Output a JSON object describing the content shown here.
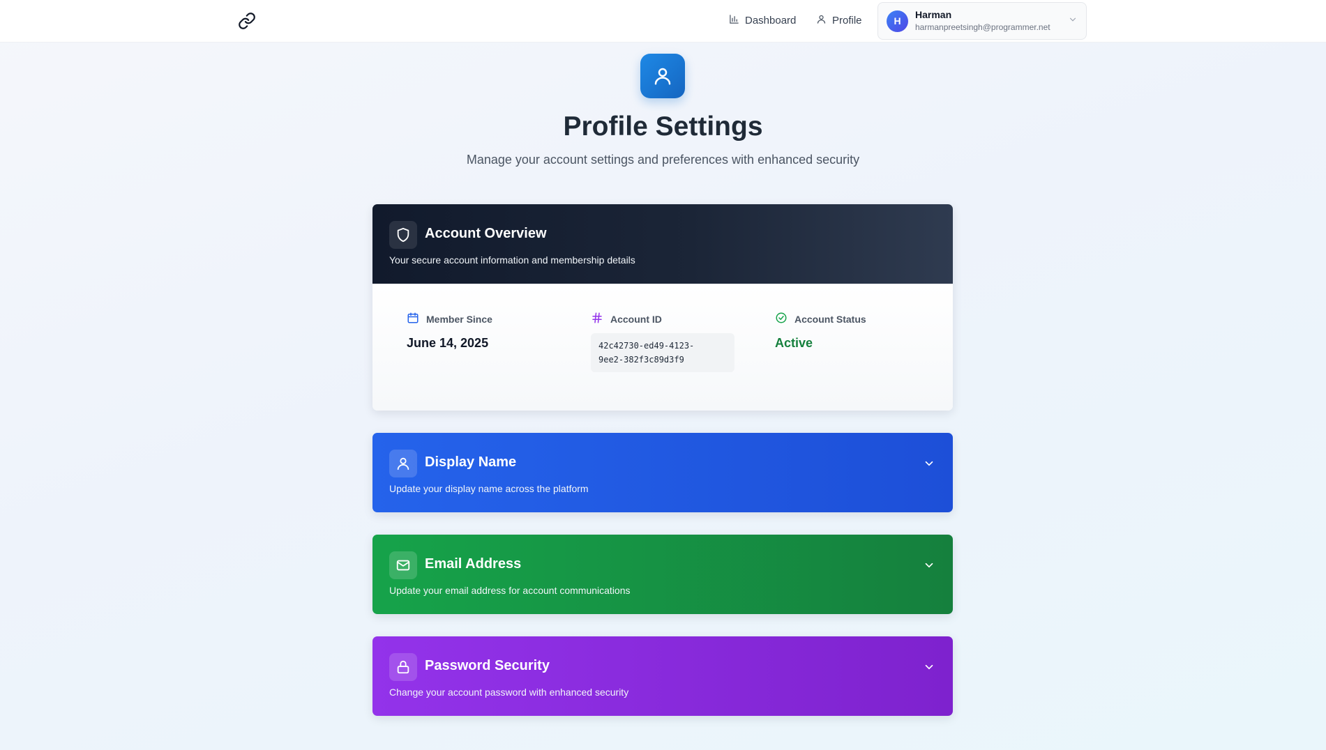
{
  "header": {
    "logo_icon": "link-icon",
    "nav": [
      {
        "label": "Dashboard",
        "icon": "bar-chart-icon"
      },
      {
        "label": "Profile",
        "icon": "user-icon"
      }
    ],
    "user": {
      "initial": "H",
      "name": "Harman",
      "email": "harmanpreetsingh@programmer.net"
    }
  },
  "hero": {
    "icon": "user-icon",
    "title": "Profile Settings",
    "subtitle": "Manage your account settings and preferences with enhanced security"
  },
  "overview": {
    "icon": "shield-icon",
    "title": "Account Overview",
    "subtitle": "Your secure account information and membership details",
    "member_since": {
      "label": "Member Since",
      "value": "June 14, 2025",
      "icon": "calendar-icon"
    },
    "account_id": {
      "label": "Account ID",
      "value_line1": "42c42730-ed49-4123-",
      "value_line2": "9ee2-382f3c89d3f9",
      "icon": "hash-icon"
    },
    "account_status": {
      "label": "Account Status",
      "value": "Active",
      "icon": "check-circle-icon"
    }
  },
  "sections": {
    "display_name": {
      "icon": "user-icon",
      "title": "Display Name",
      "subtitle": "Update your display name across the platform"
    },
    "email": {
      "icon": "mail-icon",
      "title": "Email Address",
      "subtitle": "Update your email address for account communications"
    },
    "password": {
      "icon": "lock-icon",
      "title": "Password Security",
      "subtitle": "Change your account password with enhanced security"
    }
  },
  "colors": {
    "display_name": "#2563eb",
    "email": "#16a34a",
    "password": "#9333ea",
    "overview_header": "#111a2c",
    "status_active": "#15803d"
  }
}
